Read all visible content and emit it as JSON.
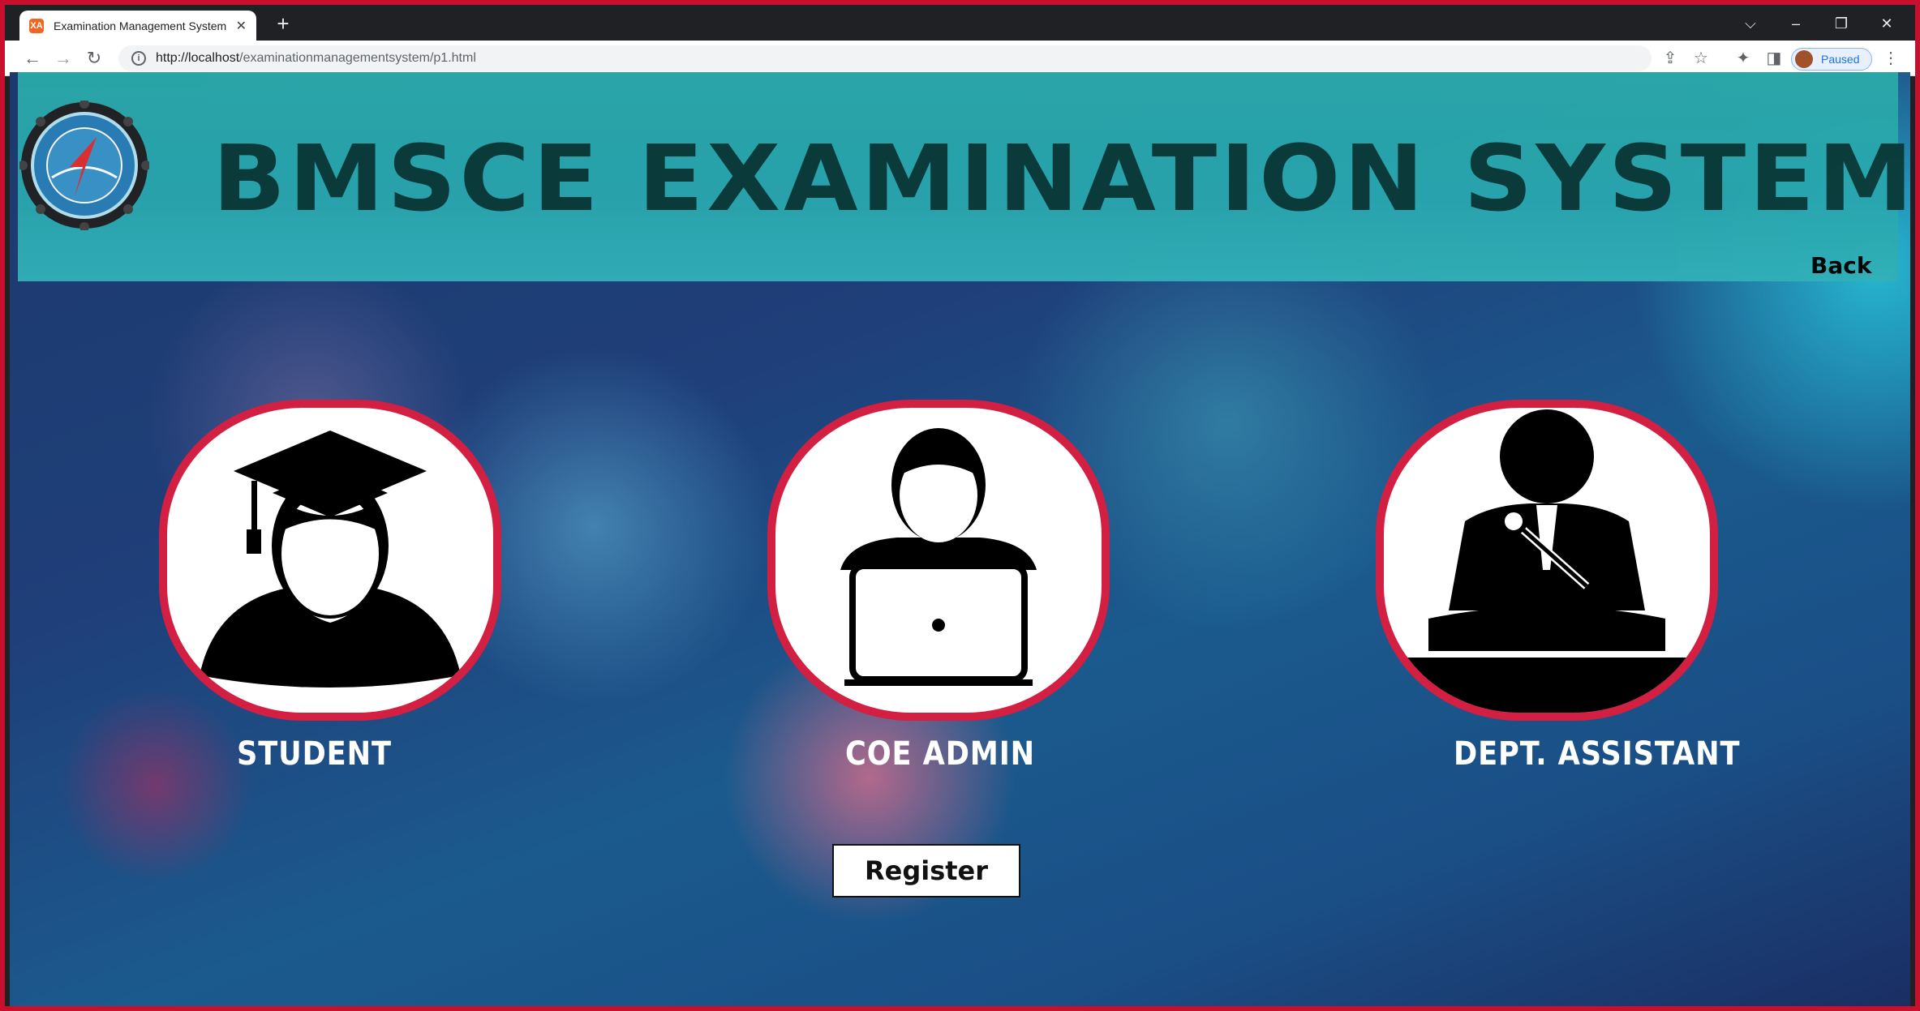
{
  "browser": {
    "tab_title": "Examination Management System",
    "tab_favicon_text": "XA",
    "new_tab": "+",
    "url_host": "http://localhost",
    "url_path": "/examinationmanagementsystem/p1.html",
    "profile_label": "Paused",
    "window_controls": {
      "tab_search": "⌵",
      "minimize": "–",
      "restore": "❐",
      "close": "✕"
    },
    "icons": {
      "back": "←",
      "forward": "→",
      "reload": "↻",
      "info": "i",
      "share": "⇪",
      "bookmark": "☆",
      "extensions": "✦",
      "sidepanel": "◨",
      "menu": "⋮"
    }
  },
  "header": {
    "title": "BMSCE EXAMINATION SYSTEM",
    "back_label": "Back"
  },
  "roles": [
    {
      "label": "STUDENT",
      "icon": "student-graduate-icon"
    },
    {
      "label": "COE ADMIN",
      "icon": "admin-laptop-icon"
    },
    {
      "label": "DEPT. ASSISTANT",
      "icon": "speaker-podium-icon"
    }
  ],
  "register_label": "Register",
  "colors": {
    "accent_border": "#d21f42",
    "header_bg": "#2aa9a9",
    "title_color": "#0a3a38"
  }
}
